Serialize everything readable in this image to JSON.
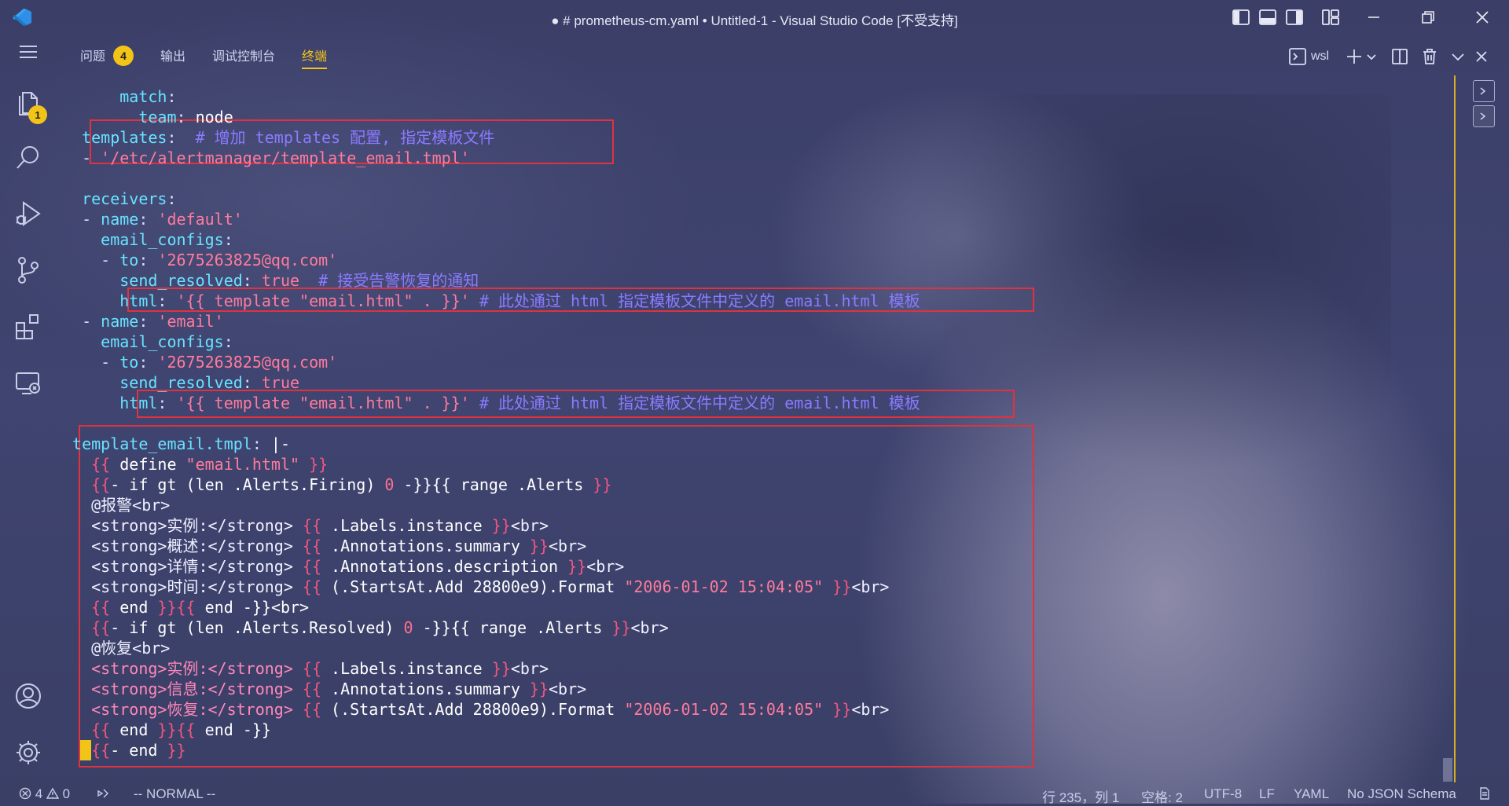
{
  "window": {
    "title": "● # prometheus-cm.yaml • Untitled-1 - Visual Studio Code [不受支持]"
  },
  "activity": {
    "explorer_badge": "1"
  },
  "panel": {
    "tabs": [
      {
        "label": "问题",
        "badge": "4"
      },
      {
        "label": "输出"
      },
      {
        "label": "调试控制台"
      },
      {
        "label": "终端",
        "active": true
      }
    ],
    "shell_label": "wsl"
  },
  "terminal": {
    "lines": [
      [
        {
          "t": "      match",
          "c": "k"
        },
        {
          "t": ":",
          "c": "c"
        }
      ],
      [
        {
          "t": "        team",
          "c": "k"
        },
        {
          "t": ": ",
          "c": "c"
        },
        {
          "t": "node",
          "c": "v"
        }
      ],
      [
        {
          "t": "  templates",
          "c": "k"
        },
        {
          "t": ":  ",
          "c": "c"
        },
        {
          "t": "# 增加 templates 配置, 指定模板文件",
          "c": "cm"
        }
      ],
      [
        {
          "t": "  - ",
          "c": "c"
        },
        {
          "t": "'/etc/alertmanager/template_email.tmpl'",
          "c": "s"
        }
      ],
      [],
      [
        {
          "t": "  receivers",
          "c": "k"
        },
        {
          "t": ":",
          "c": "c"
        }
      ],
      [
        {
          "t": "  - ",
          "c": "c"
        },
        {
          "t": "name",
          "c": "k"
        },
        {
          "t": ": ",
          "c": "c"
        },
        {
          "t": "'default'",
          "c": "s"
        }
      ],
      [
        {
          "t": "    email_configs",
          "c": "k"
        },
        {
          "t": ":",
          "c": "c"
        }
      ],
      [
        {
          "t": "    - ",
          "c": "c"
        },
        {
          "t": "to",
          "c": "k"
        },
        {
          "t": ": ",
          "c": "c"
        },
        {
          "t": "'2675263825@qq.com'",
          "c": "s"
        }
      ],
      [
        {
          "t": "      send_resolved",
          "c": "k"
        },
        {
          "t": ": ",
          "c": "c"
        },
        {
          "t": "true",
          "c": "s"
        },
        {
          "t": "  # 接受告警恢复的通知",
          "c": "cm"
        }
      ],
      [
        {
          "t": "      html",
          "c": "k"
        },
        {
          "t": ": ",
          "c": "c"
        },
        {
          "t": "'{{ template \"email.html\" . }}'",
          "c": "s"
        },
        {
          "t": " # 此处通过 html 指定模板文件中定义的 email.html 模板",
          "c": "cm"
        }
      ],
      [
        {
          "t": "  - ",
          "c": "c"
        },
        {
          "t": "name",
          "c": "k"
        },
        {
          "t": ": ",
          "c": "c"
        },
        {
          "t": "'email'",
          "c": "s"
        }
      ],
      [
        {
          "t": "    email_configs",
          "c": "k"
        },
        {
          "t": ":",
          "c": "c"
        }
      ],
      [
        {
          "t": "    - ",
          "c": "c"
        },
        {
          "t": "to",
          "c": "k"
        },
        {
          "t": ": ",
          "c": "c"
        },
        {
          "t": "'2675263825@qq.com'",
          "c": "s"
        }
      ],
      [
        {
          "t": "      send_resolved",
          "c": "k"
        },
        {
          "t": ": ",
          "c": "c"
        },
        {
          "t": "true",
          "c": "s"
        }
      ],
      [
        {
          "t": "      html",
          "c": "k"
        },
        {
          "t": ": ",
          "c": "c"
        },
        {
          "t": "'{{ template \"email.html\" . }}'",
          "c": "s"
        },
        {
          "t": " # 此处通过 html 指定模板文件中定义的 email.html 模板",
          "c": "cm"
        }
      ],
      [],
      [
        {
          "t": " template_email.tmpl",
          "c": "k"
        },
        {
          "t": ": ",
          "c": "c"
        },
        {
          "t": "|-",
          "c": "v"
        }
      ],
      [
        {
          "t": "   ",
          "c": "c"
        },
        {
          "t": "{{",
          "c": "br"
        },
        {
          "t": " define ",
          "c": "v"
        },
        {
          "t": "\"email.html\"",
          "c": "s"
        },
        {
          "t": " }}",
          "c": "br"
        }
      ],
      [
        {
          "t": "   ",
          "c": "c"
        },
        {
          "t": "{{",
          "c": "br"
        },
        {
          "t": "- if gt (len .Alerts.Firing) ",
          "c": "v"
        },
        {
          "t": "0",
          "c": "num"
        },
        {
          "t": " -}}{{ range .Alerts ",
          "c": "v"
        },
        {
          "t": "}}",
          "c": "br"
        }
      ],
      [
        {
          "t": "   @报警<br>",
          "c": "tag"
        }
      ],
      [
        {
          "t": "   <strong>实例:</strong> ",
          "c": "tag"
        },
        {
          "t": "{{",
          "c": "br"
        },
        {
          "t": " .Labels.instance ",
          "c": "v"
        },
        {
          "t": "}}",
          "c": "br"
        },
        {
          "t": "<br>",
          "c": "tag"
        }
      ],
      [
        {
          "t": "   <strong>概述:</strong> ",
          "c": "tag"
        },
        {
          "t": "{{",
          "c": "br"
        },
        {
          "t": " .Annotations.summary ",
          "c": "v"
        },
        {
          "t": "}}",
          "c": "br"
        },
        {
          "t": "<br>",
          "c": "tag"
        }
      ],
      [
        {
          "t": "   <strong>详情:</strong> ",
          "c": "tag"
        },
        {
          "t": "{{",
          "c": "br"
        },
        {
          "t": " .Annotations.description ",
          "c": "v"
        },
        {
          "t": "}}",
          "c": "br"
        },
        {
          "t": "<br>",
          "c": "tag"
        }
      ],
      [
        {
          "t": "   <strong>时间:</strong> ",
          "c": "tag"
        },
        {
          "t": "{{",
          "c": "br"
        },
        {
          "t": " (.StartsAt.Add 28800e9).Format ",
          "c": "v"
        },
        {
          "t": "\"2006-01-02 15:04:05\"",
          "c": "s"
        },
        {
          "t": " }}",
          "c": "br"
        },
        {
          "t": "<br>",
          "c": "tag"
        }
      ],
      [
        {
          "t": "   ",
          "c": "c"
        },
        {
          "t": "{{",
          "c": "br"
        },
        {
          "t": " end ",
          "c": "v"
        },
        {
          "t": "}}{{",
          "c": "br"
        },
        {
          "t": " end -}}<br>",
          "c": "v"
        }
      ],
      [
        {
          "t": "   ",
          "c": "c"
        },
        {
          "t": "{{",
          "c": "br"
        },
        {
          "t": "- if gt (len .Alerts.Resolved) ",
          "c": "v"
        },
        {
          "t": "0",
          "c": "num"
        },
        {
          "t": " -}}{{ range .Alerts ",
          "c": "v"
        },
        {
          "t": "}}",
          "c": "br"
        },
        {
          "t": "<br>",
          "c": "tag"
        }
      ],
      [
        {
          "t": "   @恢复<br>",
          "c": "tag"
        }
      ],
      [
        {
          "t": "   <strong>实例:</strong> ",
          "c": "tagp"
        },
        {
          "t": "{{",
          "c": "br"
        },
        {
          "t": " .Labels.instance ",
          "c": "v"
        },
        {
          "t": "}}",
          "c": "br"
        },
        {
          "t": "<br>",
          "c": "tag"
        }
      ],
      [
        {
          "t": "   <strong>信息:</strong> ",
          "c": "tagp"
        },
        {
          "t": "{{",
          "c": "br"
        },
        {
          "t": " .Annotations.summary ",
          "c": "v"
        },
        {
          "t": "}}",
          "c": "br"
        },
        {
          "t": "<br>",
          "c": "tag"
        }
      ],
      [
        {
          "t": "   <strong>恢复:</strong> ",
          "c": "tagp"
        },
        {
          "t": "{{",
          "c": "br"
        },
        {
          "t": " (.StartsAt.Add 28800e9).Format ",
          "c": "v"
        },
        {
          "t": "\"2006-01-02 15:04:05\"",
          "c": "s"
        },
        {
          "t": " }}",
          "c": "br"
        },
        {
          "t": "<br>",
          "c": "tag"
        }
      ],
      [
        {
          "t": "   ",
          "c": "c"
        },
        {
          "t": "{{",
          "c": "br"
        },
        {
          "t": " end ",
          "c": "v"
        },
        {
          "t": "}}{{",
          "c": "br"
        },
        {
          "t": " end -}}",
          "c": "v"
        }
      ],
      [
        {
          "t": "   ",
          "c": "c"
        },
        {
          "t": "{{",
          "c": "br"
        },
        {
          "t": "- end ",
          "c": "v"
        },
        {
          "t": "}}",
          "c": "br"
        }
      ]
    ]
  },
  "status": {
    "errors": "4",
    "warnings": "0",
    "mode": "-- NORMAL --",
    "position": "行 235，列 1",
    "indent": "空格: 2",
    "encoding": "UTF-8",
    "eol": "LF",
    "language": "YAML",
    "schema": "No JSON Schema"
  }
}
